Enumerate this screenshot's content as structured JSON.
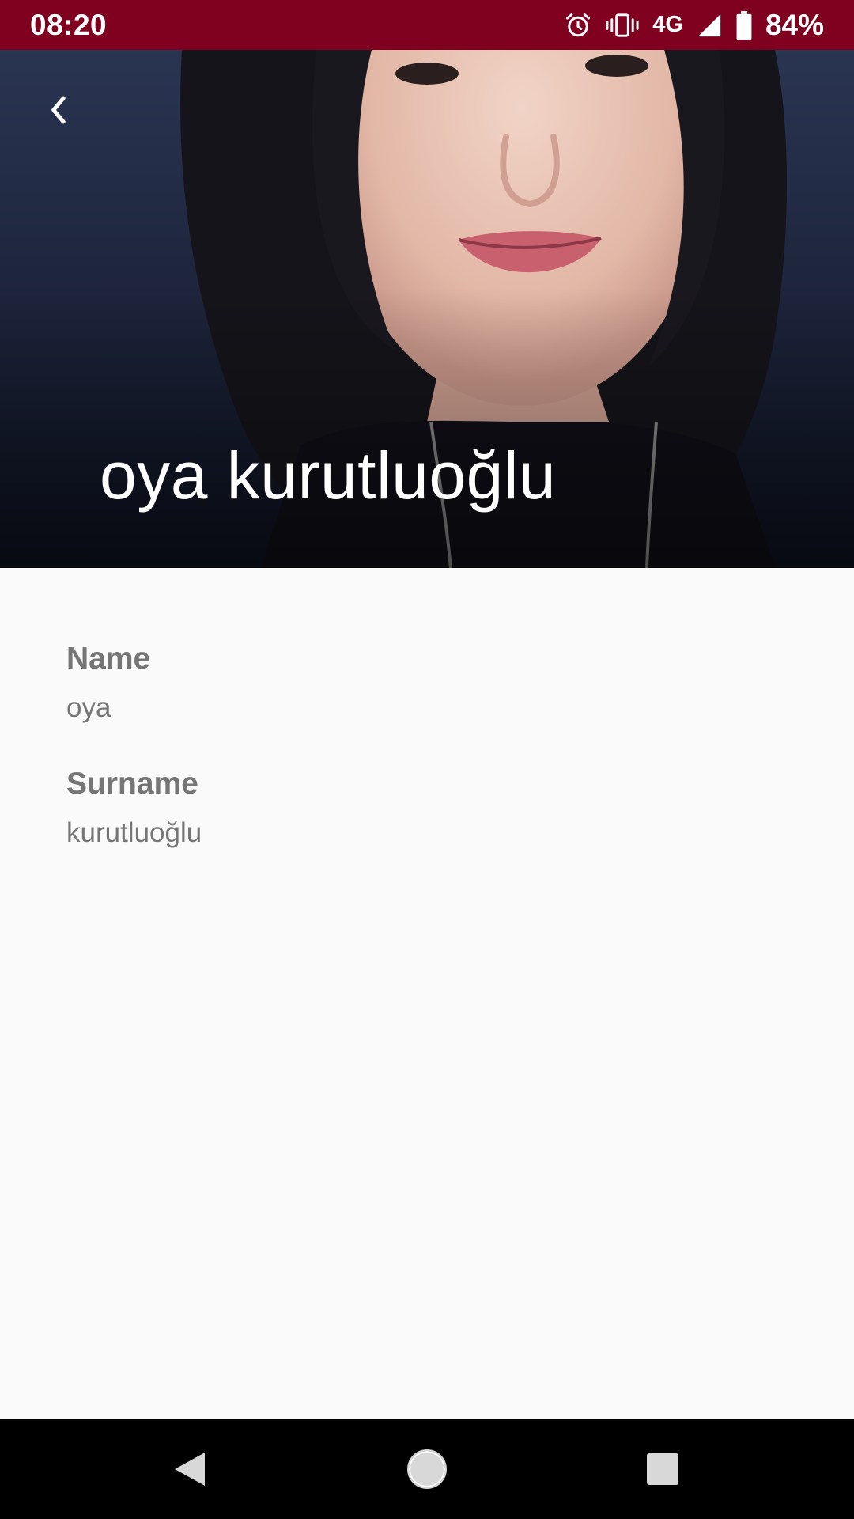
{
  "status_bar": {
    "time": "08:20",
    "network": "4G",
    "battery": "84%",
    "background_color": "#800020",
    "icons": [
      "alarm-icon",
      "vibrate-icon",
      "signal-icon",
      "battery-icon"
    ]
  },
  "header": {
    "title": "oya kurutluoğlu",
    "back_icon": "chevron-left-icon"
  },
  "fields": [
    {
      "label": "Name",
      "value": "oya"
    },
    {
      "label": "Surname",
      "value": "kurutluoğlu"
    }
  ],
  "nav_bar": {
    "icons": [
      "nav-back-icon",
      "nav-home-icon",
      "nav-recents-icon"
    ]
  }
}
